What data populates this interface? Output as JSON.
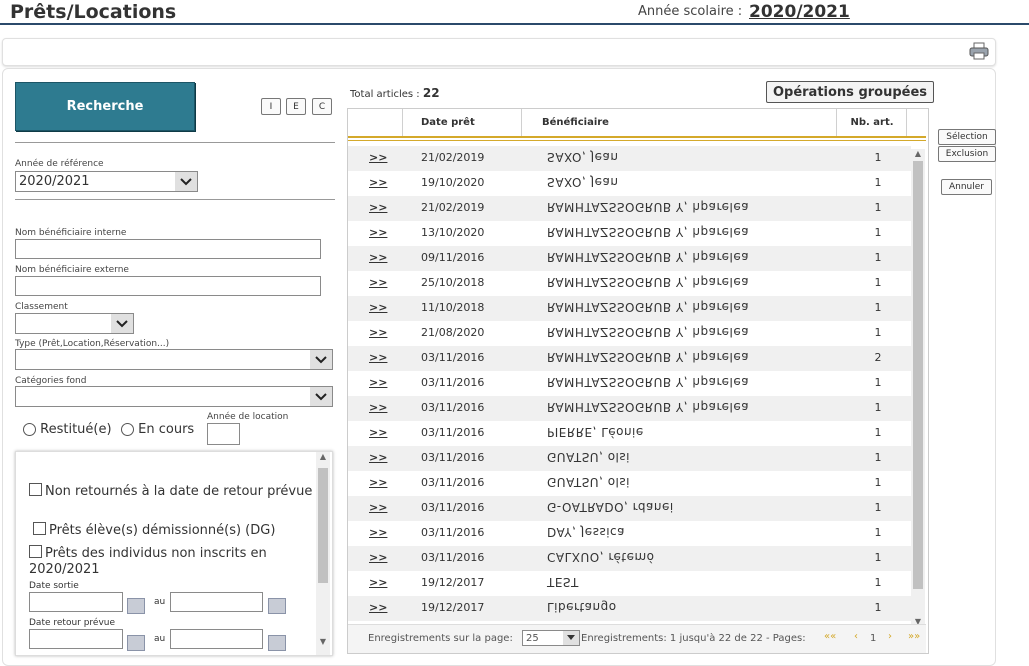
{
  "header": {
    "title": "Prêts/Locations",
    "school_year_label": "Année scolaire :",
    "school_year_value": "2020/2021"
  },
  "toolbar": {
    "print_icon": "printer-icon"
  },
  "search": {
    "button_label": "Recherche",
    "mini_buttons": [
      "I",
      "E",
      "C"
    ],
    "ref_year_label": "Année de référence",
    "ref_year_value": "2020/2021",
    "internal_name_label": "Nom bénéficiaire interne",
    "external_name_label": "Nom bénéficiaire externe",
    "classement_label": "Classement",
    "type_label": "Type (Prêt,Location,Réservation...)",
    "categories_label": "Catégories fond",
    "radio_returned": "Restitué(e)",
    "radio_ongoing": "En cours",
    "rental_year_label": "Année de location",
    "check_not_returned": "Non retournés à la date de retour prévue",
    "check_resigned": "Prêts élève(s) démissionné(s) (DG)",
    "check_not_enrolled": "Prêts des individus non inscrits en 2020/2021",
    "date_out_label": "Date sortie",
    "date_return_label": "Date retour prévue",
    "au_label": "au"
  },
  "grid": {
    "total_label": "Total articles :",
    "total_value": "22",
    "group_ops_label": "Opérations groupées",
    "columns": [
      "Date prêt",
      "Bénéficiaire",
      "Nb. art."
    ],
    "link_text": ">>",
    "rows": [
      {
        "date": "21/02/2019",
        "beneficiary": "SAXO, Jean",
        "count": "1"
      },
      {
        "date": "19/10/2020",
        "beneficiary": "SAXO, Jean",
        "count": "1"
      },
      {
        "date": "21/02/2019",
        "beneficiary": "RAMHTAZSSOGRUB Y, hparelea",
        "count": "1"
      },
      {
        "date": "13/10/2020",
        "beneficiary": "RAMHTAZSSOGRUB Y, hparelea",
        "count": "1"
      },
      {
        "date": "09/11/2016",
        "beneficiary": "RAMHTAZSSOGRUB Y, hparelea",
        "count": "1"
      },
      {
        "date": "25/10/2018",
        "beneficiary": "RAMHTAZSSOGRUB Y, hparelea",
        "count": "1"
      },
      {
        "date": "11/10/2018",
        "beneficiary": "RAMHTAZSSOGRUB Y, hparelea",
        "count": "1"
      },
      {
        "date": "21/08/2020",
        "beneficiary": "RAMHTAZSSOGRUB Y, hparelea",
        "count": "1"
      },
      {
        "date": "03/11/2016",
        "beneficiary": "RAMHTAZSSOGRUB Y, hparelea",
        "count": "2"
      },
      {
        "date": "03/11/2016",
        "beneficiary": "RAMHTAZSSOGRUB Y, hparelea",
        "count": "1"
      },
      {
        "date": "03/11/2016",
        "beneficiary": "RAMHTAZSSOGRUB Y, hparelea",
        "count": "1"
      },
      {
        "date": "03/11/2016",
        "beneficiary": "PIERRE, Léonie",
        "count": "1"
      },
      {
        "date": "03/11/2016",
        "beneficiary": "GUATSU, olsi",
        "count": "1"
      },
      {
        "date": "03/11/2016",
        "beneficiary": "GUATSU, olsi",
        "count": "1"
      },
      {
        "date": "03/11/2016",
        "beneficiary": "G-OATRADO, rdanei",
        "count": "1"
      },
      {
        "date": "03/11/2016",
        "beneficiary": "DAY, Jessica",
        "count": "1"
      },
      {
        "date": "03/11/2016",
        "beneficiary": "CALXUO, rétemó",
        "count": "1"
      },
      {
        "date": "19/12/2017",
        "beneficiary": "TEST",
        "count": "1"
      },
      {
        "date": "19/12/2017",
        "beneficiary": "Libertango",
        "count": "1"
      }
    ],
    "pager": {
      "per_page_label": "Enregistrements sur la page:",
      "per_page_value": "25",
      "records_text": "Enregistrements: 1 jusqu'à 22 de 22 - Pages:",
      "first": "««",
      "prev": "‹",
      "page": "1",
      "next": "›",
      "last": "»»"
    }
  },
  "side_buttons": {
    "selection": "Sélection",
    "exclusion": "Exclusion",
    "cancel": "Annuler"
  },
  "colors": {
    "accent": "#2e7b90",
    "header_line": "#2b4a6b",
    "gold": "#d4a92b"
  }
}
